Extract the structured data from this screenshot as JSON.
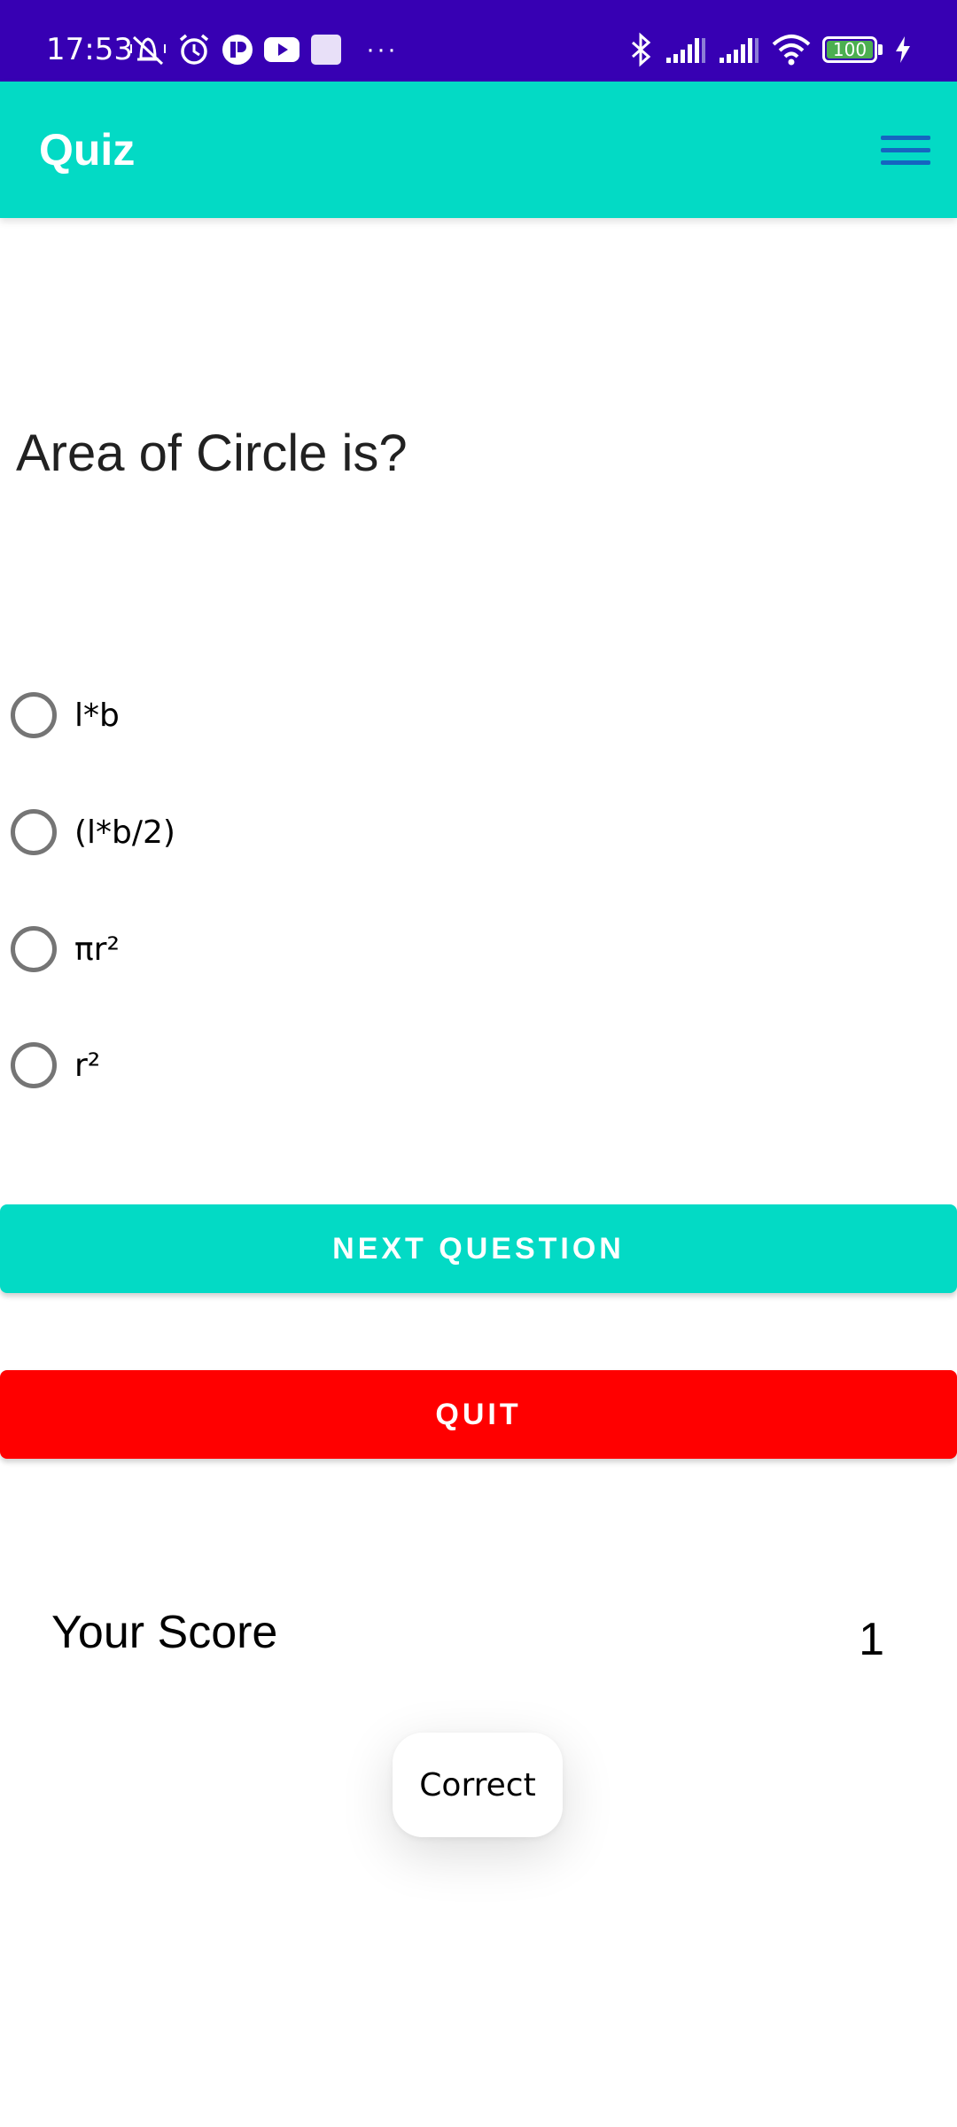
{
  "status_bar": {
    "time": "17:53",
    "background": "#3700b3",
    "left_icons": [
      "vibrate-off-icon",
      "alarm-icon",
      "app-notification-icon",
      "youtube-icon",
      "square-notification-icon",
      "more-dots-icon"
    ],
    "more_label": "···",
    "right_icons": [
      "bluetooth-icon",
      "signal-icon",
      "signal-icon",
      "wifi-icon",
      "battery-icon",
      "charging-icon"
    ],
    "battery_level": "100"
  },
  "app_bar": {
    "title": "Quiz",
    "background": "#03dac5",
    "menu_icon": "hamburger-menu-icon"
  },
  "question": {
    "text": "Area of Circle is?"
  },
  "options": [
    {
      "label": "l*b",
      "selected": false
    },
    {
      "label": "(l*b/2)",
      "selected": false
    },
    {
      "label": "πr²",
      "selected": false
    },
    {
      "label": "r²",
      "selected": false
    }
  ],
  "buttons": {
    "next_label": "NEXT QUESTION",
    "next_color": "#03dac5",
    "quit_label": "QUIT",
    "quit_color": "#ff0000"
  },
  "score": {
    "label": "Your Score",
    "value": "1"
  },
  "toast": {
    "text": "Correct"
  }
}
